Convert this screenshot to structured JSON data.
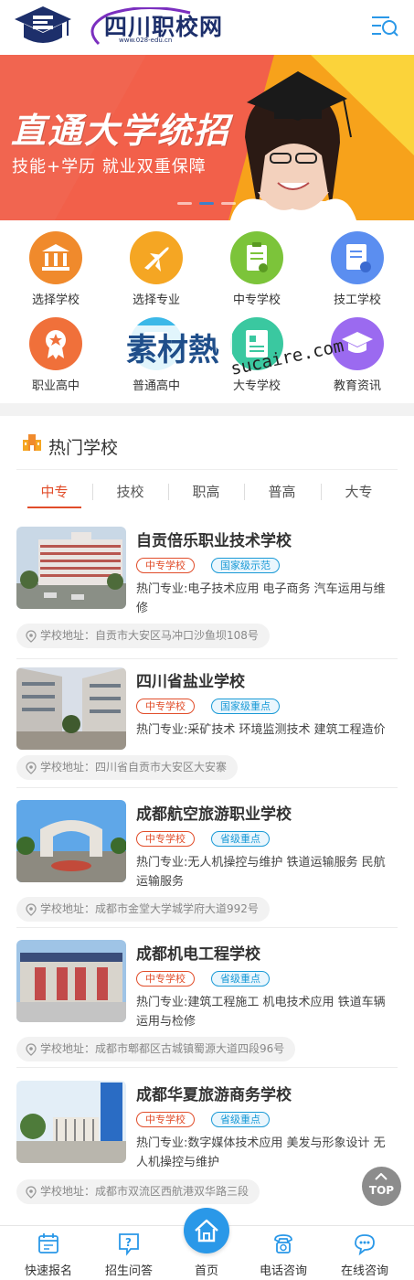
{
  "header": {
    "site_name": "四川职校网",
    "site_url": "www.028-edu.cn",
    "menu_icon": "menu-search-icon"
  },
  "banner": {
    "headline": "直通大学统招",
    "subline": "技能+学历   就业双重保障",
    "slide_count": 3,
    "active_slide": 2
  },
  "categories": [
    {
      "label": "选择学校",
      "icon": "school-building-icon",
      "color": "#f08a2c"
    },
    {
      "label": "选择专业",
      "icon": "airplane-icon",
      "color": "#f5a623"
    },
    {
      "label": "中专学校",
      "icon": "clipboard-icon",
      "color": "#7cc43a"
    },
    {
      "label": "技工学校",
      "icon": "document-edit-icon",
      "color": "#5b8ef0"
    },
    {
      "label": "职业高中",
      "icon": "award-badge-icon",
      "color": "#f0703a"
    },
    {
      "label": "普通高中",
      "icon": "book-icon",
      "color": "#3bb8e8"
    },
    {
      "label": "大专学校",
      "icon": "report-icon",
      "color": "#3ac8a0"
    },
    {
      "label": "教育资讯",
      "icon": "graduation-cap-icon",
      "color": "#9b6af0"
    }
  ],
  "watermark": {
    "brand": "素材熱",
    "domain": "sucaire.com"
  },
  "section": {
    "title": "热门学校",
    "icon": "school-icon"
  },
  "tabs": [
    {
      "label": "中专",
      "active": true
    },
    {
      "label": "技校",
      "active": false
    },
    {
      "label": "职高",
      "active": false
    },
    {
      "label": "普高",
      "active": false
    },
    {
      "label": "大专",
      "active": false
    }
  ],
  "schools": [
    {
      "name": "自贡倍乐职业技术学校",
      "tag1": "中专学校",
      "tag2": "国家级示范",
      "major": "热门专业:电子技术应用 电子商务 汽车运用与维修",
      "address": "学校地址：自贡市大安区马冲口沙鱼坝108号"
    },
    {
      "name": "四川省盐业学校",
      "tag1": "中专学校",
      "tag2": "国家级重点",
      "major": "热门专业:采矿技术 环境监测技术 建筑工程造价",
      "address": "学校地址：四川省自贡市大安区大安寨"
    },
    {
      "name": "成都航空旅游职业学校",
      "tag1": "中专学校",
      "tag2": "省级重点",
      "major": "热门专业:无人机操控与维护 铁道运输服务 民航运输服务",
      "address": "学校地址：成都市金堂大学城学府大道992号"
    },
    {
      "name": "成都机电工程学校",
      "tag1": "中专学校",
      "tag2": "省级重点",
      "major": "热门专业:建筑工程施工 机电技术应用 铁道车辆运用与检修",
      "address": "学校地址：成都市郫都区古城镇蜀源大道四段96号"
    },
    {
      "name": "成都华夏旅游商务学校",
      "tag1": "中专学校",
      "tag2": "省级重点",
      "major": "热门专业:数字媒体技术应用 美发与形象设计 无人机操控与维护",
      "address": "学校地址：成都市双流区西航港双华路三段"
    }
  ],
  "top_button": {
    "label": "TOP"
  },
  "bottom_nav": [
    {
      "label": "快速报名",
      "icon": "calendar-edit-icon"
    },
    {
      "label": "招生问答",
      "icon": "question-icon"
    },
    {
      "label": "首页",
      "icon": "home-icon"
    },
    {
      "label": "电话咨询",
      "icon": "phone-icon"
    },
    {
      "label": "在线咨询",
      "icon": "chat-icon"
    }
  ],
  "colors": {
    "accent": "#e14d2a",
    "blue": "#1a9ad6",
    "home": "#2a98e8",
    "brand": "#1d2f6b"
  }
}
